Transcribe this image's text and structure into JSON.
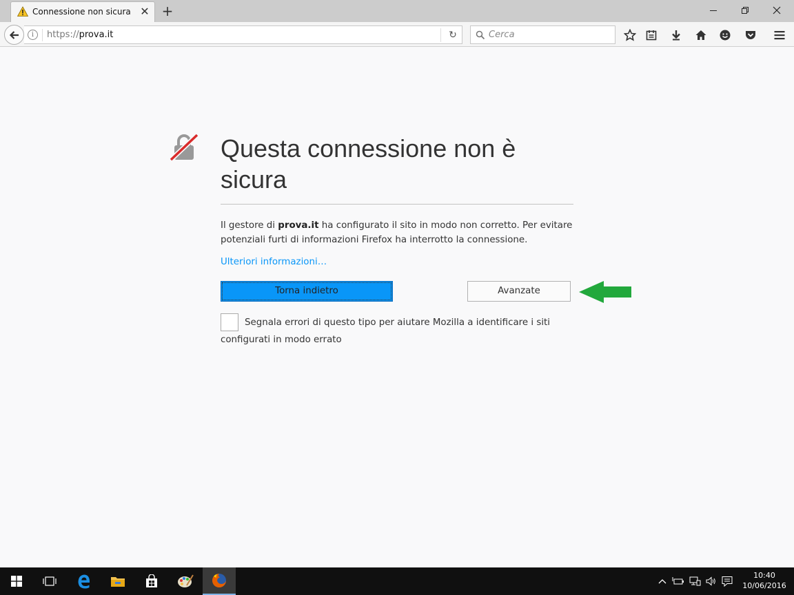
{
  "tab": {
    "title": "Connessione non sicura",
    "close": "✕"
  },
  "newtab": {
    "label": "+"
  },
  "nav": {
    "url_protocol": "https://",
    "url_host": "prova.it",
    "reload": "↻",
    "search_placeholder": "Cerca"
  },
  "error": {
    "title": "Questa connessione non è sicura",
    "desc_prefix": "Il gestore di ",
    "desc_host": "prova.it",
    "desc_suffix": " ha configurato il sito in modo non corretto. Per evitare potenziali furti di informazioni Firefox ha interrotto la connessione.",
    "more_info": "Ulteriori informazioni…",
    "back_button": "Torna indietro",
    "advanced_button": "Avanzate",
    "report_text": "Segnala errori di questo tipo per aiutare Mozilla a identificare i siti configurati in modo errato"
  },
  "clock": {
    "time": "10:40",
    "date": "10/06/2016"
  },
  "colors": {
    "accent": "#0996f8",
    "arrow": "#22a83c",
    "lock_slash": "#d92b2b"
  }
}
